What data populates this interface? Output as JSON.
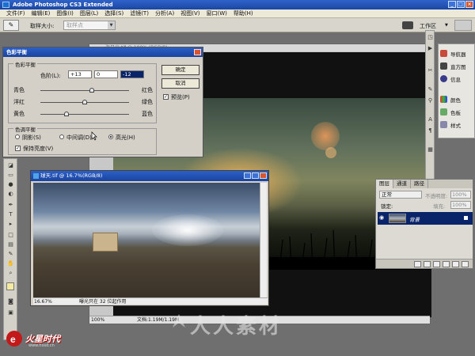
{
  "titlebar": {
    "title": "Adobe Photoshop CS3 Extended"
  },
  "menubar": {
    "items": [
      "文件(F)",
      "编辑(E)",
      "图像(I)",
      "图层(L)",
      "选择(S)",
      "滤镜(T)",
      "分析(A)",
      "视图(V)",
      "窗口(W)",
      "帮助(H)"
    ]
  },
  "options": {
    "sample_size_label": "取样大小:",
    "sample_size_value": "取样点",
    "workspace_label": "工作区"
  },
  "main_doc": {
    "title": "海日出.tif @ 100% (RGB/8)",
    "zoom": "100%",
    "info": "文档:1.19M/1.19M"
  },
  "small_doc": {
    "title": "球天.tif @ 16.7%(RGB/8)",
    "zoom": "16.67%",
    "info": "曝光只在 32 位起作用"
  },
  "color_balance": {
    "title": "色彩平衡",
    "group_balance": "色彩平衡",
    "levels_label": "色阶(L):",
    "levels": [
      "+13",
      "0",
      "-12"
    ],
    "sliders": [
      {
        "left": "青色",
        "right": "红色",
        "value": 13
      },
      {
        "left": "洋红",
        "right": "绿色",
        "value": 0
      },
      {
        "left": "黄色",
        "right": "蓝色",
        "value": -12
      }
    ],
    "group_tone": "色调平衡",
    "tones": [
      "阴影(S)",
      "中间调(D)",
      "高光(H)"
    ],
    "tone_selected": "高光(H)",
    "preserve": "保持亮度(V)",
    "ok": "确定",
    "cancel": "取消",
    "preview": "预览(P)"
  },
  "panels": {
    "items": [
      "导航器",
      "直方图",
      "信息",
      "颜色",
      "色板",
      "样式"
    ]
  },
  "layers": {
    "tabs": [
      "图层",
      "通道",
      "路径"
    ],
    "blend_mode": "正常",
    "opacity_label": "不透明度:",
    "opacity_value": "100%",
    "lock_label": "锁定:",
    "fill_label": "填充:",
    "fill_value": "100%",
    "layer_name": "背景"
  },
  "watermark": {
    "text": "人人素材"
  },
  "logo": {
    "text": "火星时代",
    "url": "www.hxsd.cn"
  },
  "colors": {
    "title_blue": "#1b47a3",
    "selection": "#0a246a"
  }
}
